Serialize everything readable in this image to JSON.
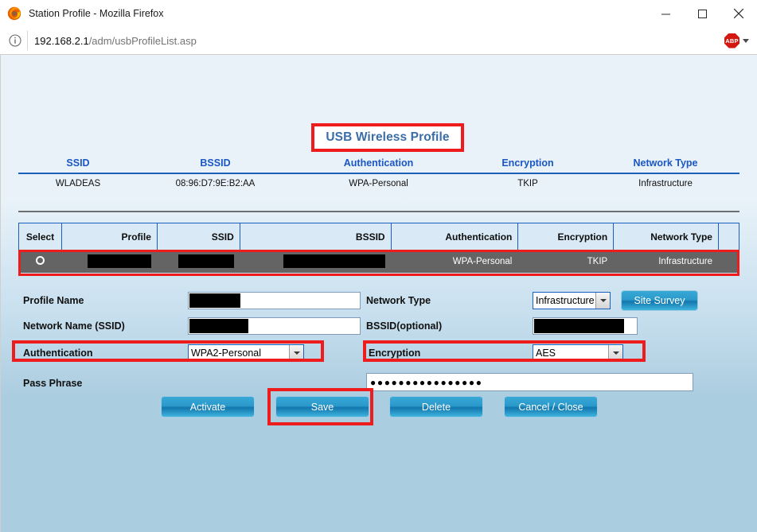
{
  "browser": {
    "title": "Station Profile - Mozilla Firefox",
    "url_host": "192.168.2.1",
    "url_path": "/adm/usbProfileList.asp",
    "minimize_label": "–",
    "maximize_label": "□",
    "close_label": "✕",
    "extension_badge": "ABP"
  },
  "page": {
    "title": "USB Wireless Profile",
    "accent_blue": "#3b6ea8",
    "highlight_red": "#ee1c1c",
    "header_blue": "#1a56c4"
  },
  "status_table": {
    "headers": [
      "SSID",
      "BSSID",
      "Authentication",
      "Encryption",
      "Network Type"
    ],
    "row": [
      "WLADEAS",
      "08:96:D7:9E:B2:AA",
      "WPA-Personal",
      "TKIP",
      "Infrastructure"
    ]
  },
  "profile_table": {
    "headers": [
      "Select",
      "Profile",
      "SSID",
      "BSSID",
      "Authentication",
      "Encryption",
      "Network Type",
      ""
    ],
    "rows": [
      {
        "selected": true,
        "profile": "",
        "ssid": "",
        "bssid": "",
        "authentication": "WPA-Personal",
        "encryption": "TKIP",
        "network_type": "Infrastructure",
        "extra": ""
      }
    ]
  },
  "form": {
    "profile_name_label": "Profile Name",
    "profile_name_value": "",
    "network_name_label": "Network Name (SSID)",
    "network_name_value": "",
    "authentication_label": "Authentication",
    "authentication_value": "WPA2-Personal",
    "network_type_label": "Network Type",
    "network_type_value": "Infrastructure",
    "bssid_label": "BSSID(optional)",
    "bssid_value": "",
    "encryption_label": "Encryption",
    "encryption_value": "AES",
    "pass_phrase_label": "Pass Phrase",
    "pass_phrase_masked": "●●●●●●●●●●●●●●●●",
    "site_survey_label": "Site Survey"
  },
  "actions": {
    "activate": "Activate",
    "save": "Save",
    "delete": "Delete",
    "cancel_close": "Cancel / Close"
  }
}
